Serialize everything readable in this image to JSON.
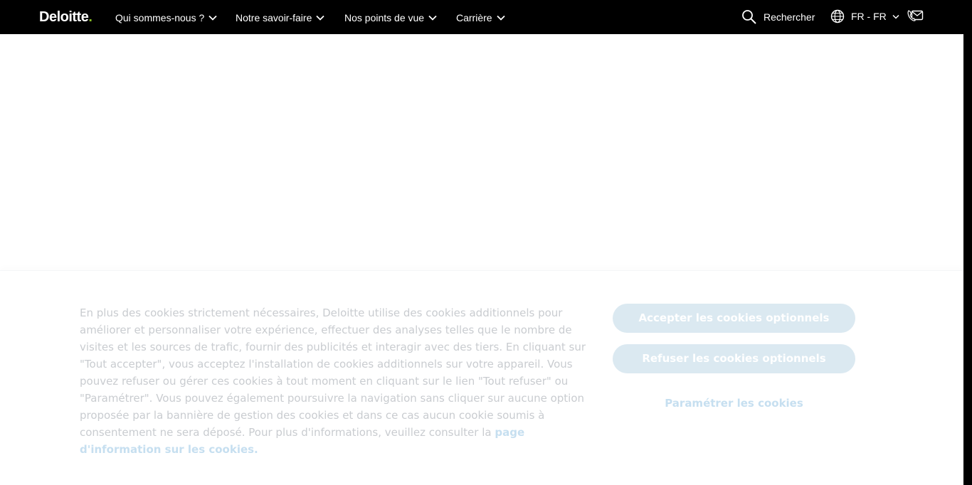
{
  "header": {
    "logo_text": "Deloitte",
    "logo_dot": ".",
    "nav": [
      {
        "label": "Qui sommes-nous ?"
      },
      {
        "label": "Notre savoir-faire"
      },
      {
        "label": "Nos points de vue"
      },
      {
        "label": "Carrière"
      }
    ],
    "search_label": "Rechercher",
    "language_label": "FR - FR"
  },
  "cookie_banner": {
    "text": "En plus des cookies strictement nécessaires, Deloitte utilise des cookies additionnels pour améliorer et personnaliser votre expérience, effectuer des analyses telles que le nombre de visites et les sources de trafic, fournir des publicités et interagir avec des tiers. En cliquant sur \"Tout accepter\", vous acceptez l'installation de cookies additionnels sur votre appareil. Vous pouvez refuser ou gérer ces cookies à tout moment en cliquant sur le lien \"Tout refuser\" ou \"Paramétrer\". Vous pouvez également poursuivre la navigation sans cliquer sur aucune option proposée par la bannière de gestion des cookies et dans ce cas aucun cookie soumis à consentement ne sera déposé. Pour plus d'informations, veuillez consulter la ",
    "link_text": "page d'information sur les cookies.",
    "accept_label": "Accepter les cookies optionnels",
    "refuse_label": "Refuser les cookies optionnels",
    "settings_label": "Paramétrer les cookies"
  },
  "icons": {
    "search": "search-icon",
    "globe": "globe-icon",
    "chevron": "chevron-down-icon",
    "contact": "phone-mail-icon"
  },
  "colors": {
    "nav_bg": "#000000",
    "brand_green": "#86bc25",
    "button_bg": "#dbe9f1",
    "link": "#c6dff0"
  }
}
